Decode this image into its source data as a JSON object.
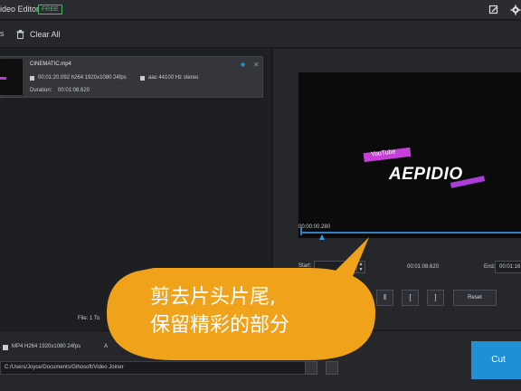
{
  "app": {
    "title": "ideo Editor",
    "badge": "FREE"
  },
  "toolbar": {
    "clear_all": "Clear All",
    "left_glyph": "s"
  },
  "file": {
    "name": "CINEMATIC.mp4",
    "video_meta": "00:01:20.092 h264 1920x1080 24fps",
    "audio_meta": "aac 44100 Hz stereo",
    "duration_label": "Duration:",
    "duration_value": "00:01:08.620"
  },
  "file_count": "File: 1  To",
  "preview": {
    "youtube_text": "YouTube",
    "brand": "AEPIDIO",
    "timecode": "00:00:00.280"
  },
  "trim": {
    "start_label": "Start:",
    "end_time_text": "00:01:08.620",
    "end_label": "End:",
    "end_value": "00:01:16",
    "pause_glyph": "‖",
    "mark_in_glyph": "[",
    "mark_out_glyph": "]",
    "reset_label": "Reset"
  },
  "output": {
    "format": "MP4 H264 1920x1080 24fps",
    "audio_prefix": "A",
    "path": "C:/Users/Joyce/Documents/Gihosoft/Video Joiner",
    "cut_label": "Cut"
  },
  "callout": {
    "line1": "剪去片头片尾,",
    "line2": "保留精彩的部分",
    "color": "#f0a21a"
  }
}
